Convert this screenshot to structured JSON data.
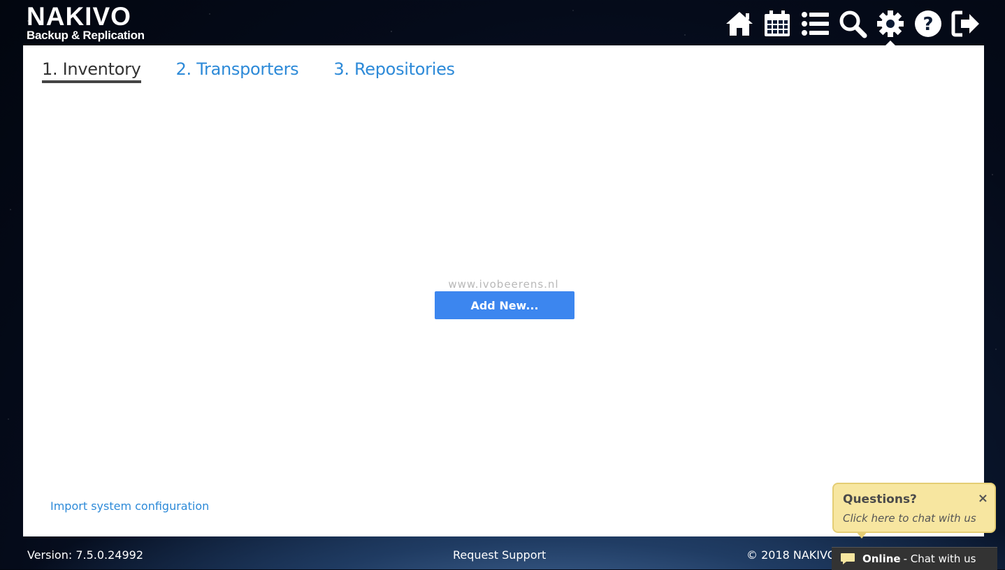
{
  "header": {
    "logo_main": "NAKIVO",
    "logo_sub": "Backup & Replication",
    "icons": [
      "home-icon",
      "calendar-icon",
      "list-icon",
      "search-icon",
      "gear-icon",
      "help-icon",
      "logout-icon"
    ],
    "active_icon": "gear-icon"
  },
  "tabs": [
    {
      "label": "1. Inventory",
      "active": true
    },
    {
      "label": "2. Transporters",
      "active": false
    },
    {
      "label": "3. Repositories",
      "active": false
    }
  ],
  "main": {
    "watermark": "www.ivobeerens.nl",
    "add_new_label": "Add New...",
    "import_link": "Import system configuration"
  },
  "footer": {
    "version": "Version: 7.5.0.24992",
    "request_support": "Request Support",
    "copyright": "© 2018 NAKIVO"
  },
  "chat": {
    "title": "Questions?",
    "subtitle": "Click here to chat with us",
    "close": "×",
    "status": "Online",
    "action": "- Chat with us"
  },
  "colors": {
    "accent": "#3c86ef",
    "link": "#2d8ad8",
    "chat_bubble": "#f7e6a0",
    "chat_bar": "#333333"
  }
}
